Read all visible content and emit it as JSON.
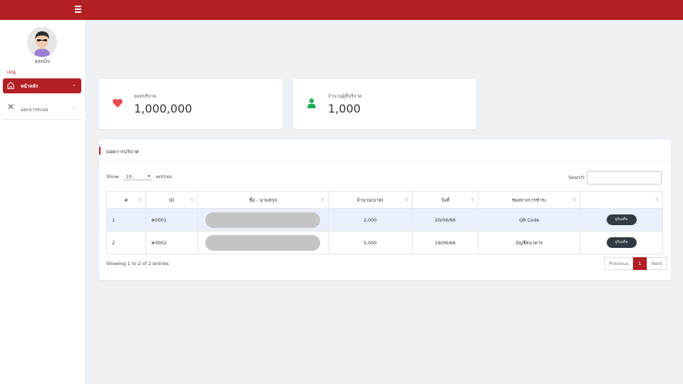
{
  "sidebar": {
    "username": "ยอดนิบ",
    "menu_heading": "เมนู",
    "items": [
      {
        "label": "หน้าหลัก",
        "icon": "home-icon",
        "chevron": "–"
      },
      {
        "label": "ออกจากระบบ",
        "icon": "close-icon",
        "chevron": "–"
      }
    ]
  },
  "stats": [
    {
      "label": "ยอดบริจาค",
      "value": "1,000,000",
      "icon": "heart-icon",
      "color": "#e54b4b"
    },
    {
      "label": "จำนวนผู้ที่บริจาค",
      "value": "1,000",
      "icon": "user-icon",
      "color": "#1fae5b"
    }
  ],
  "panel": {
    "title": "ยอดการบริจาค",
    "show_label": "Show",
    "entries_value": "10",
    "entries_label": "entries",
    "search_label": "Search:",
    "columns": [
      "#",
      "ID",
      "ชื่อ - นามสกุล",
      "จำนวน(บาท)",
      "วันที่",
      "ช่องทางการชำระ",
      ""
    ],
    "rows": [
      {
        "num": "1",
        "id": "#0001",
        "amount": "2,000",
        "date": "20/06/66",
        "channel": "QR Code",
        "action": "ดูใบเสร็จ"
      },
      {
        "num": "2",
        "id": "#0002",
        "amount": "5,000",
        "date": "19/06/66",
        "channel": "บัญชีธนาคาร",
        "action": "ดูใบเสร็จ"
      }
    ],
    "info": "Showing 1 to 2 of 2 entries",
    "pagination": {
      "previous": "Previous",
      "current": "1",
      "next": "Next"
    }
  },
  "colors": {
    "brand": "#b22024",
    "background": "#eef1f4",
    "button_dark": "#323b44"
  }
}
